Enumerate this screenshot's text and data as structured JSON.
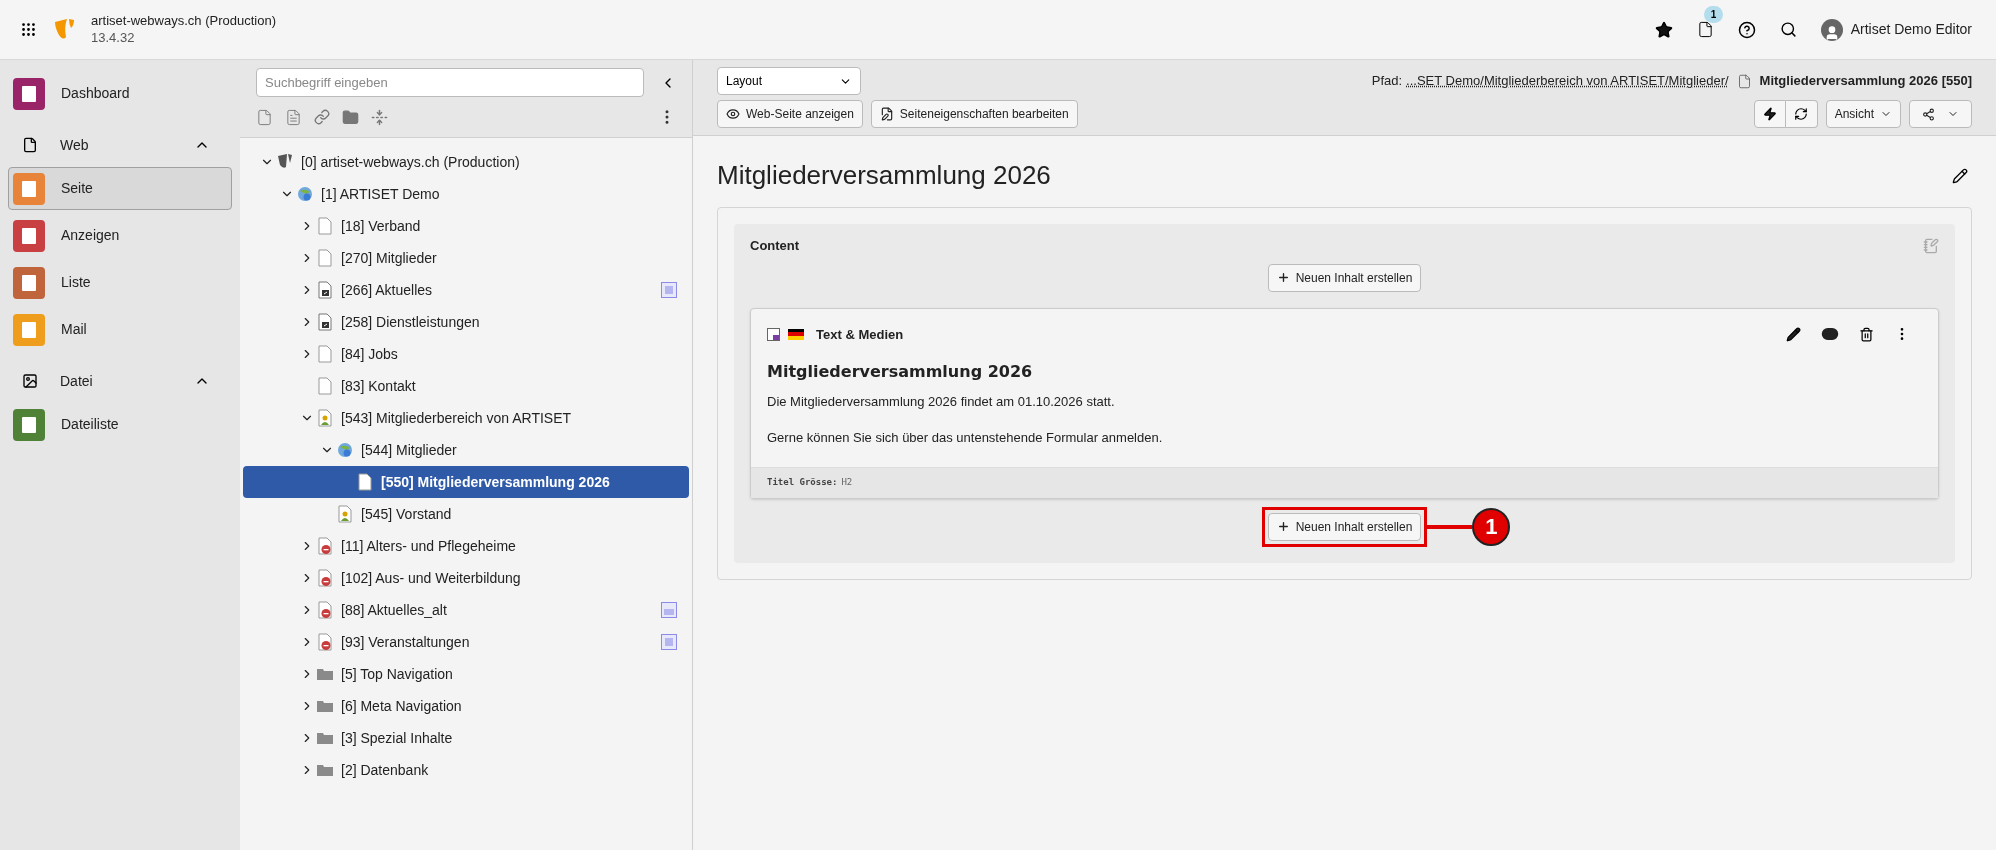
{
  "topbar": {
    "site_name": "artiset-webways.ch (Production)",
    "version": "13.4.32",
    "notification_count": "1",
    "user_name": "Artiset Demo Editor"
  },
  "sidebar": [
    {
      "kind": "module",
      "label": "Dashboard",
      "color": "#9a2468",
      "selected": false
    },
    {
      "kind": "group",
      "label": "Web",
      "expanded": true,
      "children": [
        {
          "kind": "module",
          "label": "Seite",
          "color": "#e8843a",
          "selected": true
        },
        {
          "kind": "module",
          "label": "Anzeigen",
          "color": "#c84042",
          "selected": false
        },
        {
          "kind": "module",
          "label": "Liste",
          "color": "#c0653b",
          "selected": false
        },
        {
          "kind": "module",
          "label": "Mail",
          "color": "#ee9d1c",
          "selected": false
        }
      ]
    },
    {
      "kind": "group",
      "label": "Datei",
      "expanded": true,
      "children": [
        {
          "kind": "module",
          "label": "Dateiliste",
          "color": "#4f8137",
          "selected": false
        }
      ]
    }
  ],
  "page_tree": {
    "search": {
      "placeholder": "Suchbegriff eingeben"
    },
    "nodes": [
      {
        "label": "[0] artiset-webways.ch (Production)",
        "kind": "root",
        "expanded": true,
        "selected": false,
        "children": [
          {
            "label": "[1] ARTISET Demo",
            "kind": "site",
            "expanded": true,
            "selected": false,
            "children": [
              {
                "label": "[18] Verband",
                "kind": "page",
                "expanded": false,
                "selected": false
              },
              {
                "label": "[270] Mitglieder",
                "kind": "page",
                "expanded": false,
                "selected": false
              },
              {
                "label": "[266] Aktuelles",
                "kind": "shortcut",
                "expanded": false,
                "selected": false,
                "marker": {
                  "kind": "note"
                }
              },
              {
                "label": "[258] Dienstleistungen",
                "kind": "shortcut",
                "expanded": false,
                "selected": false
              },
              {
                "label": "[84] Jobs",
                "kind": "page",
                "expanded": false,
                "selected": false
              },
              {
                "label": "[83] Kontakt",
                "kind": "page",
                "selected": false
              },
              {
                "label": "[543] Mitgliederbereich von ARTISET",
                "kind": "restricted",
                "expanded": true,
                "selected": false,
                "children": [
                  {
                    "label": "[544] Mitglieder",
                    "kind": "site",
                    "expanded": true,
                    "selected": false,
                    "children": [
                      {
                        "label": "[550] Mitgliederversammlung 2026",
                        "kind": "page",
                        "selected": true
                      }
                    ]
                  },
                  {
                    "label": "[545] Vorstand",
                    "kind": "restricted",
                    "selected": false
                  }
                ]
              },
              {
                "label": "[11] Alters- und Pflegeheime",
                "kind": "hidden",
                "expanded": false,
                "selected": false
              },
              {
                "label": "[102] Aus- und Weiterbildung",
                "kind": "hidden",
                "expanded": false,
                "selected": false
              },
              {
                "label": "[88] Aktuelles_alt",
                "kind": "hidden",
                "expanded": false,
                "selected": false,
                "marker": {
                  "kind": "image"
                }
              },
              {
                "label": "[93] Veranstaltungen",
                "kind": "hidden",
                "expanded": false,
                "selected": false,
                "marker": {
                  "kind": "note"
                }
              },
              {
                "label": "[5] Top Navigation",
                "kind": "folder",
                "expanded": false,
                "selected": false
              },
              {
                "label": "[6] Meta Navigation",
                "kind": "folder",
                "expanded": false,
                "selected": false
              },
              {
                "label": "[3] Spezial Inhalte",
                "kind": "folder",
                "expanded": false,
                "selected": false
              },
              {
                "label": "[2] Datenbank",
                "kind": "folder",
                "expanded": false,
                "selected": false
              }
            ]
          }
        ]
      }
    ]
  },
  "docheader": {
    "layout_select": "Layout",
    "buttons": [
      "Web-Seite anzeigen",
      "Seiteneigenschaften bearbeiten"
    ],
    "path_label": "Pfad:",
    "path_link": "...SET Demo/Mitgliederbereich von ARTISET/Mitglieder/",
    "path_page": "Mitgliederversammlung 2026 [550]",
    "view_button": "Ansicht"
  },
  "page_title": "Mitgliederversammlung 2026",
  "column": {
    "title": "Content",
    "new_content_buttons": [
      "Neuen Inhalt erstellen",
      "Neuen Inhalt erstellen"
    ],
    "element": {
      "type": "Text & Medien",
      "header": "Mitgliederversammlung 2026",
      "paragraphs": [
        "Die Mitgliederversammlung 2026 findet am 01.10.2026 statt.",
        "Gerne können Sie sich über das untenstehende Formular anmelden."
      ],
      "footer_label": "Titel Grösse:",
      "footer_value": "H2",
      "visible": true
    }
  },
  "annotation": {
    "number": "1"
  }
}
